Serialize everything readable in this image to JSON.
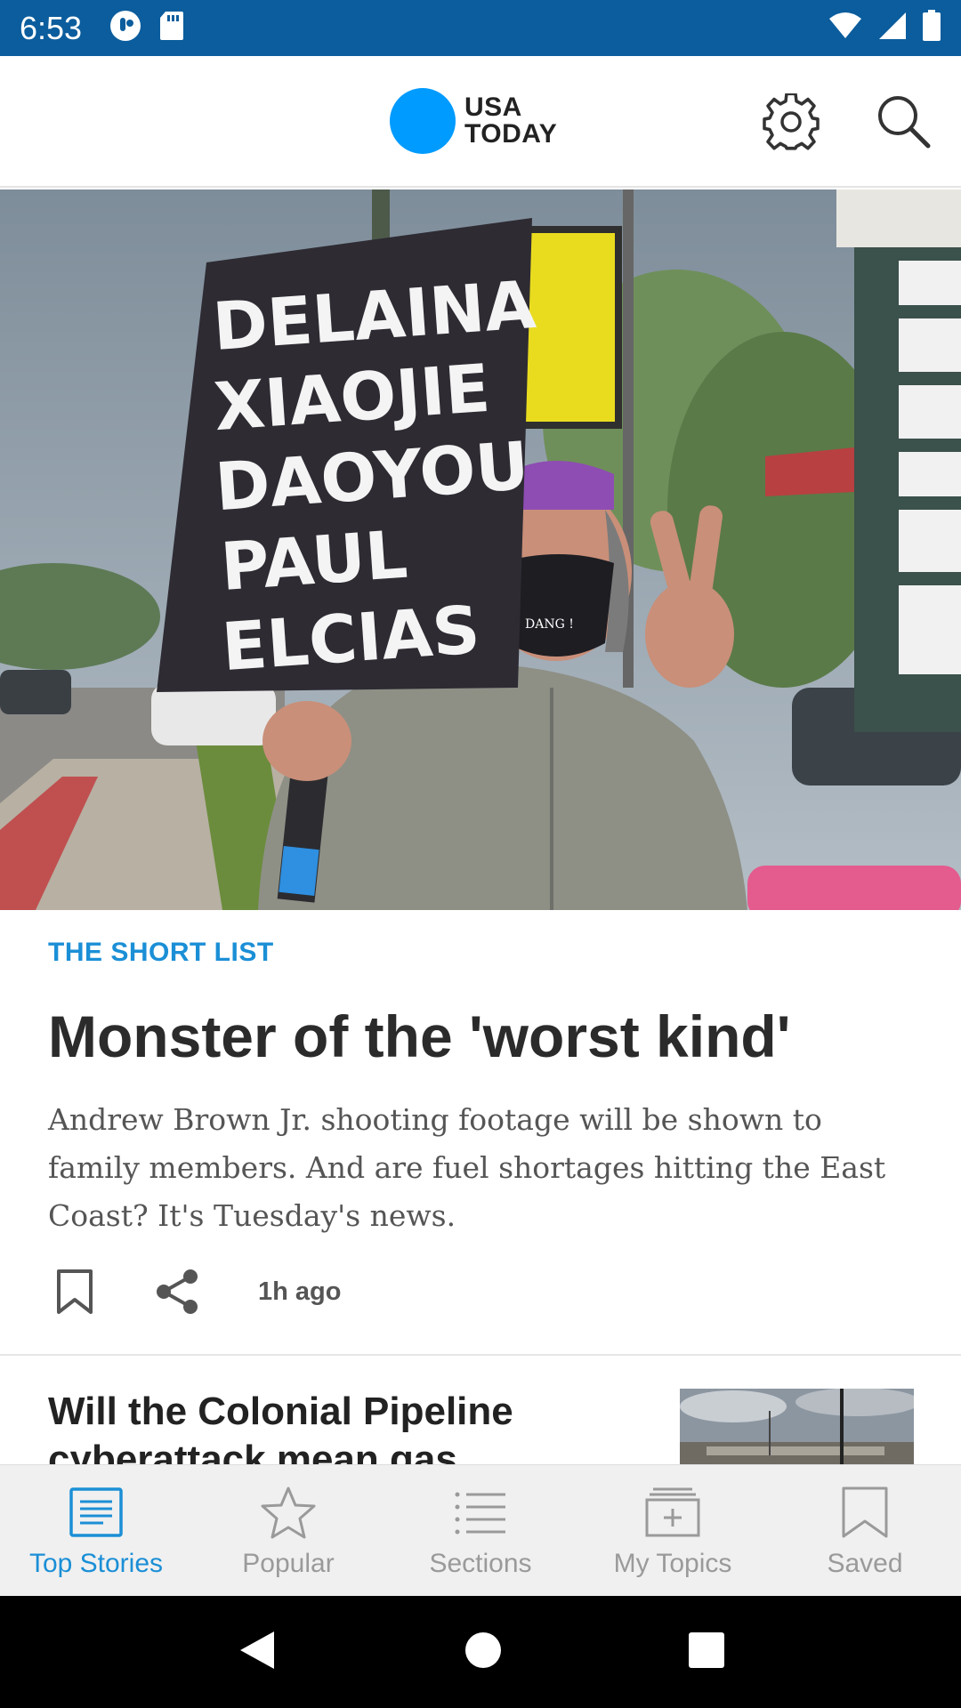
{
  "status_bar": {
    "time": "6:53",
    "left_icons": [
      "app-notification-icon",
      "sd-card-icon"
    ],
    "right_icons": [
      "wifi-icon",
      "cell-signal-icon",
      "battery-icon"
    ]
  },
  "header": {
    "logo_line1": "USA",
    "logo_line2": "TODAY",
    "brand_color": "#009bff",
    "icons": [
      "settings-icon",
      "search-icon"
    ]
  },
  "hero_image": {
    "sign_lines": [
      "DELAINA",
      "XIAOJIE",
      "DAOYOU",
      "PAUL",
      "ELCIAS"
    ],
    "mask_text": "DANG !"
  },
  "article": {
    "kicker": "THE SHORT LIST",
    "headline": "Monster of the 'worst kind'",
    "summary": "Andrew Brown Jr. shooting footage will be shown to family members. And are fuel shortages hitting the East Coast? It's Tuesday's news.",
    "timestamp": "1h ago"
  },
  "story2": {
    "title": "Will the Colonial Pipeline cyberattack mean gas"
  },
  "bottom_nav": {
    "items": [
      {
        "label": "Top Stories",
        "icon": "top-stories-icon",
        "active": true
      },
      {
        "label": "Popular",
        "icon": "star-icon",
        "active": false
      },
      {
        "label": "Sections",
        "icon": "list-icon",
        "active": false
      },
      {
        "label": "My Topics",
        "icon": "add-folder-icon",
        "active": false
      },
      {
        "label": "Saved",
        "icon": "bookmark-icon",
        "active": false
      }
    ]
  },
  "colors": {
    "status_bar": "#0b5d9d",
    "accent": "#1b8fd6",
    "nav_inactive": "#9a9a9a"
  }
}
